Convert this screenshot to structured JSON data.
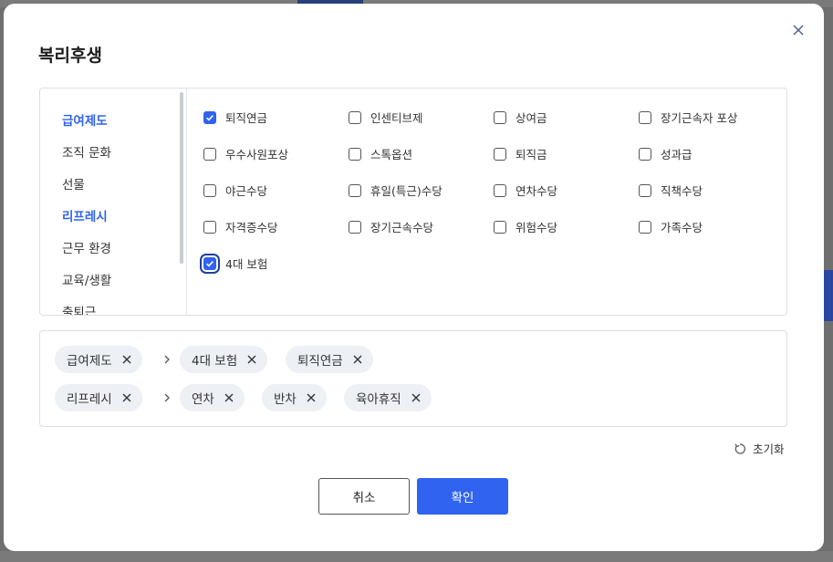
{
  "dialog": {
    "title": "복리후생",
    "close_icon": "close-icon"
  },
  "categories": [
    {
      "label": "급여제도",
      "active": true
    },
    {
      "label": "조직 문화",
      "active": false
    },
    {
      "label": "선물",
      "active": false
    },
    {
      "label": "리프레시",
      "active": true
    },
    {
      "label": "근무 환경",
      "active": false
    },
    {
      "label": "교육/생활",
      "active": false
    },
    {
      "label": "출퇴근",
      "active": false
    }
  ],
  "options": [
    {
      "label": "퇴직연금",
      "checked": true
    },
    {
      "label": "인센티브제",
      "checked": false
    },
    {
      "label": "상여금",
      "checked": false
    },
    {
      "label": "장기근속자 포상",
      "checked": false
    },
    {
      "label": "우수사원포상",
      "checked": false
    },
    {
      "label": "스톡옵션",
      "checked": false
    },
    {
      "label": "퇴직금",
      "checked": false
    },
    {
      "label": "성과급",
      "checked": false
    },
    {
      "label": "야근수당",
      "checked": false
    },
    {
      "label": "휴일(특근)수당",
      "checked": false
    },
    {
      "label": "연차수당",
      "checked": false
    },
    {
      "label": "직책수당",
      "checked": false
    },
    {
      "label": "자격증수당",
      "checked": false
    },
    {
      "label": "장기근속수당",
      "checked": false
    },
    {
      "label": "위험수당",
      "checked": false
    },
    {
      "label": "가족수당",
      "checked": false
    },
    {
      "label": "4대 보험",
      "checked": true
    }
  ],
  "selected_groups": [
    {
      "category": "급여제도",
      "items": [
        "4대 보험",
        "퇴직연금"
      ]
    },
    {
      "category": "리프레시",
      "items": [
        "연차",
        "반차",
        "육아휴직"
      ]
    }
  ],
  "reset_label": "초기화",
  "buttons": {
    "cancel": "취소",
    "confirm": "확인"
  },
  "colors": {
    "accent": "#2f63f0",
    "chip_bg": "#edf0f5",
    "overlay": "#6f6f6f"
  }
}
